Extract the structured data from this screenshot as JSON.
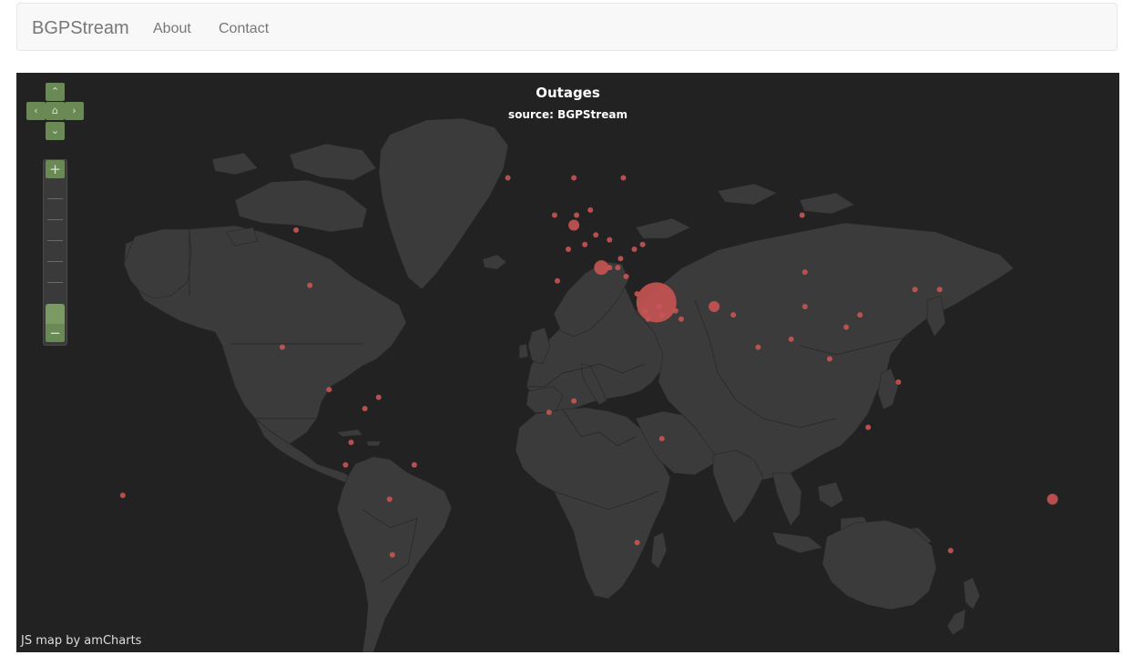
{
  "navbar": {
    "brand": "BGPStream",
    "links": [
      "About",
      "Contact"
    ]
  },
  "map": {
    "title": "Outages",
    "subtitle": "source: BGPStream",
    "credit": "JS map by amCharts",
    "colors": {
      "background": "#222222",
      "land": "#3b3b3b",
      "marker": "#c95454",
      "controls": "#6a8a55"
    },
    "controls": {
      "pan_up": "up-chevron-icon",
      "pan_down": "down-chevron-icon",
      "pan_left": "left-chevron-icon",
      "pan_right": "right-chevron-icon",
      "home": "home-icon",
      "zoom_in": "+",
      "zoom_out": "−"
    }
  },
  "chart_data": {
    "type": "bubble-map",
    "title": "Outages",
    "subtitle": "source: BGPStream",
    "markers": [
      {
        "lon": -20,
        "lat": 60,
        "size": "small"
      },
      {
        "lon": 4,
        "lat": 60,
        "size": "small"
      },
      {
        "lon": 22,
        "lat": 60,
        "size": "small"
      },
      {
        "lon": -97,
        "lat": 50,
        "size": "small"
      },
      {
        "lon": -92,
        "lat": 38,
        "size": "small"
      },
      {
        "lon": -102,
        "lat": 23,
        "size": "small"
      },
      {
        "lon": -85,
        "lat": 12,
        "size": "small"
      },
      {
        "lon": -72,
        "lat": 7,
        "size": "small"
      },
      {
        "lon": -67,
        "lat": 10,
        "size": "small"
      },
      {
        "lon": -77,
        "lat": -2,
        "size": "small"
      },
      {
        "lon": -79,
        "lat": -8,
        "size": "small"
      },
      {
        "lon": -54,
        "lat": -8,
        "size": "small"
      },
      {
        "lon": -63,
        "lat": -17,
        "size": "small"
      },
      {
        "lon": -62,
        "lat": -31,
        "size": "small"
      },
      {
        "lon": -160,
        "lat": -16,
        "size": "small"
      },
      {
        "lon": -3,
        "lat": 53,
        "size": "small"
      },
      {
        "lon": 5,
        "lat": 53,
        "size": "small"
      },
      {
        "lon": 4,
        "lat": 51,
        "size": "medium"
      },
      {
        "lon": 10,
        "lat": 54,
        "size": "small"
      },
      {
        "lon": 12,
        "lat": 49,
        "size": "small"
      },
      {
        "lon": 2,
        "lat": 46,
        "size": "small"
      },
      {
        "lon": 8,
        "lat": 47,
        "size": "small"
      },
      {
        "lon": 17,
        "lat": 48,
        "size": "small"
      },
      {
        "lon": 21,
        "lat": 44,
        "size": "small"
      },
      {
        "lon": 26,
        "lat": 46,
        "size": "small"
      },
      {
        "lon": 29,
        "lat": 47,
        "size": "small"
      },
      {
        "lon": 14,
        "lat": 42,
        "size": "large"
      },
      {
        "lon": 20,
        "lat": 42,
        "size": "small"
      },
      {
        "lon": 23,
        "lat": 40,
        "size": "small"
      },
      {
        "lon": -2,
        "lat": 39,
        "size": "small"
      },
      {
        "lon": 17,
        "lat": 42,
        "size": "small"
      },
      {
        "lon": 27,
        "lat": 36,
        "size": "small"
      },
      {
        "lon": 34,
        "lat": 34,
        "size": "xlarge"
      },
      {
        "lon": 30,
        "lat": 32,
        "size": "small"
      },
      {
        "lon": 31,
        "lat": 30,
        "size": "small"
      },
      {
        "lon": 35,
        "lat": 33,
        "size": "small"
      },
      {
        "lon": 36,
        "lat": 31,
        "size": "small"
      },
      {
        "lon": 41,
        "lat": 32,
        "size": "small"
      },
      {
        "lon": 43,
        "lat": 30,
        "size": "small"
      },
      {
        "lon": 55,
        "lat": 33,
        "size": "medium"
      },
      {
        "lon": 62,
        "lat": 31,
        "size": "small"
      },
      {
        "lon": 71,
        "lat": 23,
        "size": "small"
      },
      {
        "lon": 83,
        "lat": 25,
        "size": "small"
      },
      {
        "lon": 87,
        "lat": 53,
        "size": "small"
      },
      {
        "lon": 88,
        "lat": 41,
        "size": "small"
      },
      {
        "lon": 88,
        "lat": 33,
        "size": "small"
      },
      {
        "lon": 97,
        "lat": 20,
        "size": "small"
      },
      {
        "lon": 103,
        "lat": 28,
        "size": "small"
      },
      {
        "lon": 108,
        "lat": 31,
        "size": "small"
      },
      {
        "lon": 128,
        "lat": 37,
        "size": "small"
      },
      {
        "lon": 137,
        "lat": 37,
        "size": "small"
      },
      {
        "lon": 122,
        "lat": 14,
        "size": "small"
      },
      {
        "lon": 111,
        "lat": 2,
        "size": "small"
      },
      {
        "lon": 141,
        "lat": -30,
        "size": "small"
      },
      {
        "lon": 178,
        "lat": -17,
        "size": "medium"
      },
      {
        "lon": -5,
        "lat": 6,
        "size": "small"
      },
      {
        "lon": 4,
        "lat": 9,
        "size": "small"
      },
      {
        "lon": 36,
        "lat": -1,
        "size": "small"
      },
      {
        "lon": 27,
        "lat": -28,
        "size": "small"
      }
    ]
  }
}
